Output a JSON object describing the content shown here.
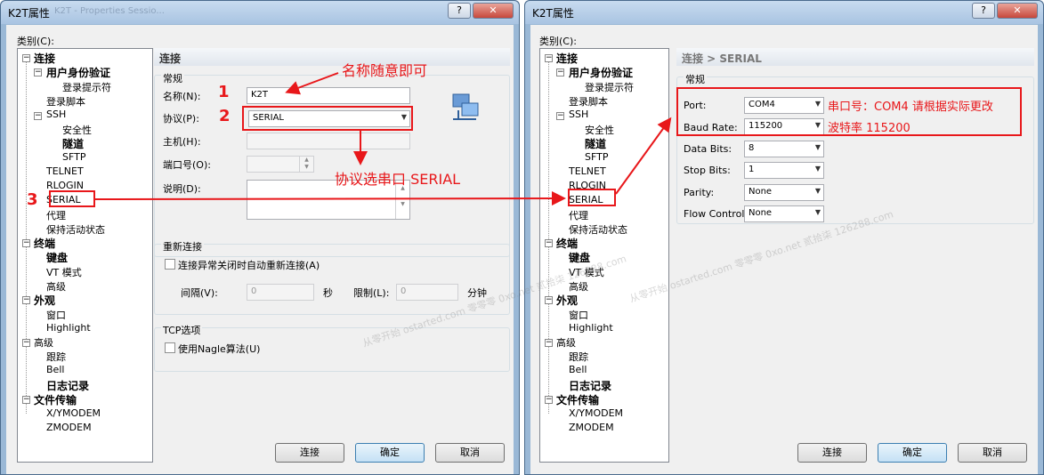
{
  "left": {
    "title": "K2T属性",
    "title_ghost": "K2T - Properties Sessio...",
    "help_btn": "?",
    "close_btn": "✕",
    "category_label": "类别(C):",
    "tree": [
      "连接",
      "用户身份验证",
      "登录提示符",
      "登录脚本",
      "SSH",
      "安全性",
      "隧道",
      "SFTP",
      "TELNET",
      "RLOGIN",
      "SERIAL",
      "代理",
      "保持活动状态",
      "终端",
      "键盘",
      "VT 模式",
      "高级",
      "外观",
      "窗口",
      "Highlight",
      "高级",
      "跟踪",
      "Bell",
      "日志记录",
      "文件传输",
      "X/YMODEM",
      "ZMODEM"
    ],
    "header": "连接",
    "general_title": "常规",
    "name_label": "名称(N):",
    "name_value": "K2T",
    "protocol_label": "协议(P):",
    "protocol_value": "SERIAL",
    "host_label": "主机(H):",
    "port_label": "端口号(O):",
    "desc_label": "说明(D):",
    "reconnect_title": "重新连接",
    "reconnect_check": "连接异常关闭时自动重新连接(A)",
    "interval_label": "间隔(V):",
    "interval_value": "0",
    "sec_unit": "秒",
    "limit_label": "限制(L):",
    "limit_value": "0",
    "min_unit": "分钟",
    "tcp_title": "TCP选项",
    "nagle_check": "使用Nagle算法(U)",
    "btn_connect": "连接",
    "btn_ok": "确定",
    "btn_cancel": "取消"
  },
  "right": {
    "title": "K2T属性",
    "help_btn": "?",
    "close_btn": "✕",
    "category_label": "类别(C):",
    "header": "连接 > SERIAL",
    "general_title": "常规",
    "port_label": "Port:",
    "port_value": "COM4",
    "baud_label": "Baud Rate:",
    "baud_value": "115200",
    "databits_label": "Data Bits:",
    "databits_value": "8",
    "stopbits_label": "Stop Bits:",
    "stopbits_value": "1",
    "parity_label": "Parity:",
    "parity_value": "None",
    "flow_label": "Flow Control:",
    "flow_value": "None",
    "btn_connect": "连接",
    "btn_ok": "确定",
    "btn_cancel": "取消"
  },
  "annotations": {
    "n1": "1",
    "n2": "2",
    "n3": "3",
    "name_note": "名称随意即可",
    "protocol_note": "协议选串口 SERIAL",
    "port_note": "串口号：COM4 请根据实际更改",
    "baud_note": "波特率 115200"
  },
  "watermarks": [
    "从零开始 ostarted.com 零零零 0xo.net 贰拾柒 126288.com",
    "从零开始 ostarted.com 零零零 0xo.net 贰拾柒 126288.com"
  ],
  "colors": {
    "annotation": "#e8171a",
    "title_bar": "#a9c4e2"
  }
}
